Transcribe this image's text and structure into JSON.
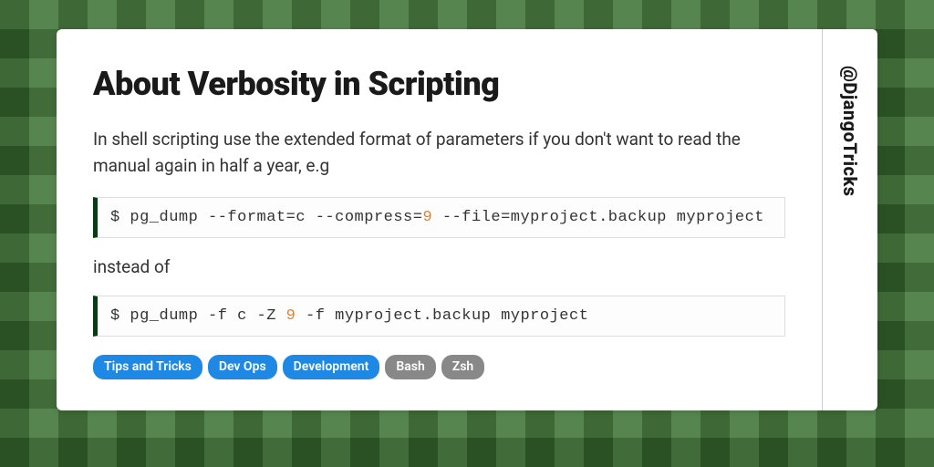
{
  "title": "About Verbosity in Scripting",
  "intro": "In shell scripting use the extended format of parameters if you don't want to read the manual again in half a year, e.g",
  "code1": {
    "pre": "$ pg_dump --format=c --compress=",
    "num": "9",
    "post": " --file=myproject.backup myproject"
  },
  "between": "instead of",
  "code2": {
    "pre": "$ pg_dump -f c -Z ",
    "num": "9",
    "post": " -f myproject.backup myproject"
  },
  "tags": {
    "primary": [
      "Tips and Tricks",
      "Dev Ops",
      "Development"
    ],
    "secondary": [
      "Bash",
      "Zsh"
    ]
  },
  "handle": "@DjangoTricks"
}
